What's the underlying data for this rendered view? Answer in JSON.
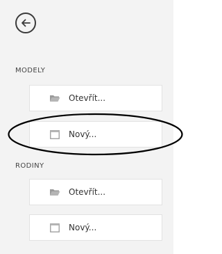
{
  "back": {
    "icon": "arrow-left-circle-icon"
  },
  "sections": [
    {
      "title": "MODELY",
      "buttons": [
        {
          "label": "Otevřít...",
          "icon": "folder-open-icon"
        },
        {
          "label": "Nový...",
          "icon": "new-file-icon"
        }
      ]
    },
    {
      "title": "RODINY",
      "buttons": [
        {
          "label": "Otevřít...",
          "icon": "folder-open-icon"
        },
        {
          "label": "Nový...",
          "icon": "new-file-icon"
        }
      ]
    }
  ],
  "colors": {
    "panel_bg": "#f3f3f3",
    "button_bg": "#ffffff",
    "annotation": "#000000"
  }
}
